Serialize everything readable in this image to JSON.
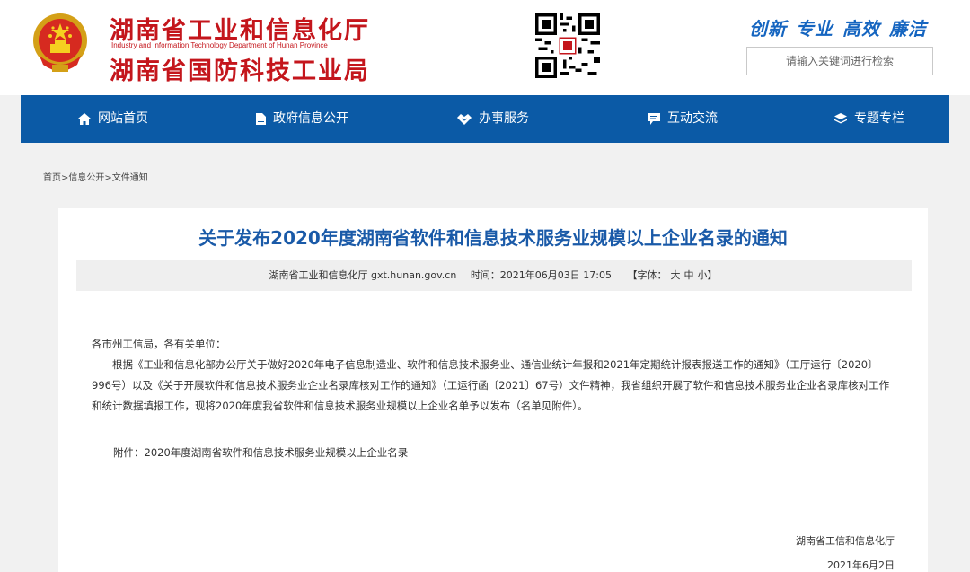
{
  "header": {
    "title_cn_1": "湖南省工业和信息化厅",
    "title_en": "Industry and Information Technology Department of Hunan Province",
    "title_cn_2": "湖南省国防科技工业局",
    "slogan": [
      "创新",
      "专业",
      "高效",
      "廉洁"
    ],
    "search_placeholder": "请输入关键词进行检索",
    "emblem_icon": "national-emblem-icon",
    "qr_icon": "qr-code-icon"
  },
  "nav": {
    "items": [
      {
        "label": "网站首页",
        "icon": "home-icon"
      },
      {
        "label": "政府信息公开",
        "icon": "document-icon"
      },
      {
        "label": "办事服务",
        "icon": "handshake-icon"
      },
      {
        "label": "互动交流",
        "icon": "chat-icon"
      },
      {
        "label": "专题专栏",
        "icon": "layers-icon"
      }
    ]
  },
  "breadcrumb": "首页>信息公开>文件通知",
  "article": {
    "title": "关于发布2020年度湖南省软件和信息技术服务业规模以上企业名录的通知",
    "meta": {
      "source": "湖南省工业和信息化厅 gxt.hunan.gov.cn",
      "time": "时间：2021年06月03日 17:05",
      "font_label": "【字体：",
      "font_large": "大",
      "font_medium": "中",
      "font_small": "小】"
    },
    "salutation": "各市州工信局，各有关单位：",
    "paragraph": "根据《工业和信息化部办公厅关于做好2020年电子信息制造业、软件和信息技术服务业、通信业统计年报和2021年定期统计报表报送工作的通知》（工厅运行〔2020〕996号）以及《关于开展软件和信息技术服务业企业名录库核对工作的通知》（工运行函〔2021〕67号）文件精神，我省组织开展了软件和信息技术服务业企业名录库核对工作和统计数据填报工作，现将2020年度我省软件和信息技术服务业规模以上企业名单予以发布（名单见附件）。",
    "attachment": "附件：2020年度湖南省软件和信息技术服务业规模以上企业名录",
    "sign_org": "湖南省工信和信息化厅",
    "sign_date": "2021年6月2日"
  },
  "colors": {
    "brand_red": "#c4161c",
    "nav_blue": "#0b5aa6",
    "title_blue": "#1a5aa8",
    "slogan_blue": "#1565c0"
  }
}
